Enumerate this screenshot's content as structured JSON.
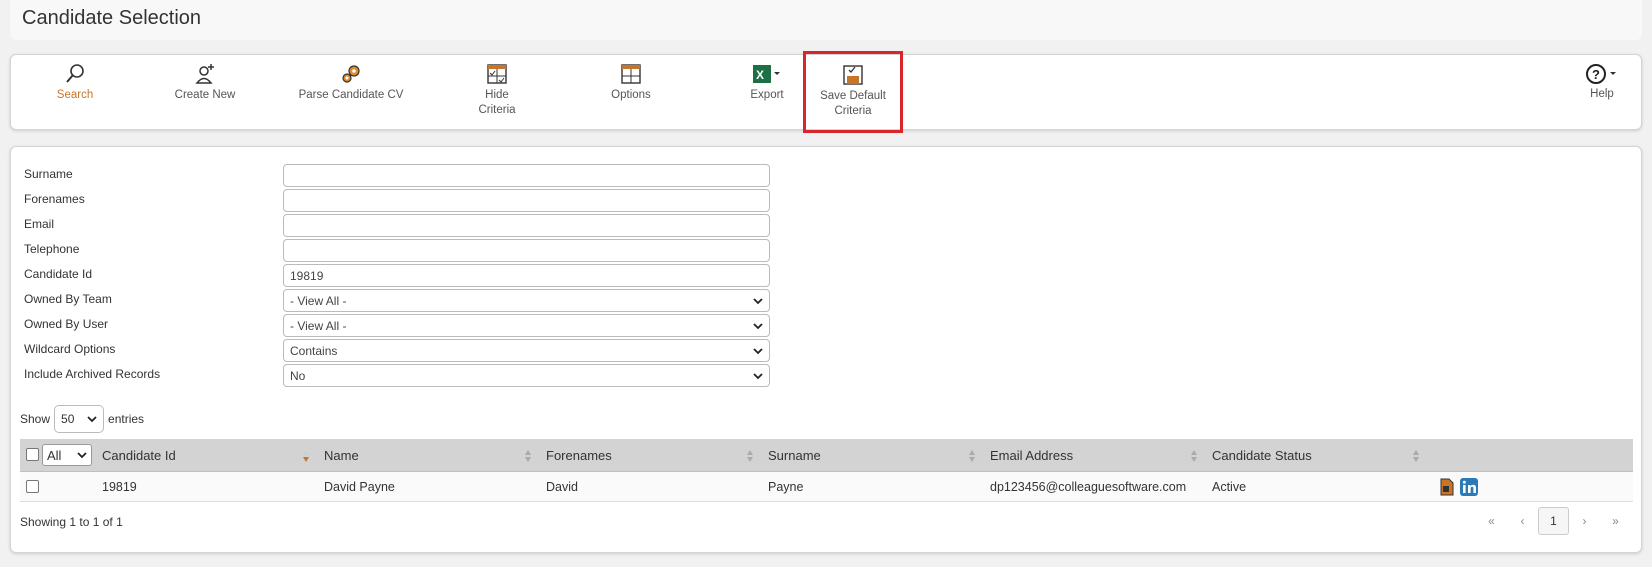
{
  "page": {
    "title": "Candidate Selection"
  },
  "toolbar": {
    "search": "Search",
    "create_new": "Create New",
    "parse_cv": "Parse Candidate CV",
    "hide_criteria_1": "Hide",
    "hide_criteria_2": "Criteria",
    "options": "Options",
    "export": "Export",
    "save_default_1": "Save Default",
    "save_default_2": "Criteria",
    "help": "Help"
  },
  "criteria": {
    "surname": {
      "label": "Surname",
      "value": ""
    },
    "forenames": {
      "label": "Forenames",
      "value": ""
    },
    "email": {
      "label": "Email",
      "value": ""
    },
    "telephone": {
      "label": "Telephone",
      "value": ""
    },
    "candidate_id": {
      "label": "Candidate Id",
      "value": "19819"
    },
    "owned_by_team": {
      "label": "Owned By Team",
      "value": "- View All -"
    },
    "owned_by_user": {
      "label": "Owned By User",
      "value": "- View All -"
    },
    "wildcard": {
      "label": "Wildcard Options",
      "value": "Contains"
    },
    "archived": {
      "label": "Include Archived Records",
      "value": "No"
    }
  },
  "show_entries": {
    "prefix": "Show",
    "value": "50",
    "suffix": "entries"
  },
  "grid": {
    "select_all": "All",
    "columns": [
      "Candidate Id",
      "Name",
      "Forenames",
      "Surname",
      "Email Address",
      "Candidate Status"
    ],
    "rows": [
      {
        "id": "19819",
        "name": "David Payne",
        "forenames": "David",
        "surname": "Payne",
        "email": "dp123456@colleaguesoftware.com",
        "status": "Active"
      }
    ]
  },
  "footer": {
    "info": "Showing 1 to 1 of 1"
  },
  "pager": {
    "first": "«",
    "prev": "‹",
    "current": "1",
    "next": "›",
    "last": "»"
  },
  "colors": {
    "accent": "#c8752a",
    "highlight": "#d9262c",
    "header_bg": "#d3d3d3",
    "linkedin": "#0a66c2"
  }
}
